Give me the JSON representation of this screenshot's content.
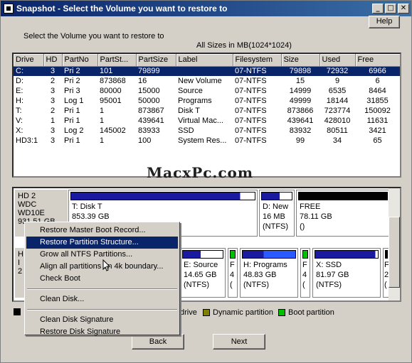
{
  "window": {
    "title": "Snapshot - Select the Volume you want to restore to",
    "help_label": "Help"
  },
  "instruction": "Select the Volume you want to restore to",
  "sizes_note": "All Sizes in MB(1024*1024)",
  "volumes": {
    "columns": [
      "Drive",
      "HD",
      "PartNo",
      "PartSt...",
      "PartSize",
      "Label",
      "Filesystem",
      "Size",
      "Used",
      "Free"
    ],
    "rows": [
      [
        "C:",
        "3",
        "Pri 2",
        "101",
        "79899",
        "",
        "07-NTFS",
        "79898",
        "72932",
        "6966"
      ],
      [
        "D:",
        "2",
        "Pri 2",
        "873868",
        "16",
        "New Volume",
        "07-NTFS",
        "15",
        "9",
        "6"
      ],
      [
        "E:",
        "3",
        "Pri 3",
        "80000",
        "15000",
        "Source",
        "07-NTFS",
        "14999",
        "6535",
        "8464"
      ],
      [
        "H:",
        "3",
        "Log 1",
        "95001",
        "50000",
        "Programs",
        "07-NTFS",
        "49999",
        "18144",
        "31855"
      ],
      [
        "T:",
        "2",
        "Pri 1",
        "1",
        "873867",
        "Disk T",
        "07-NTFS",
        "873866",
        "723774",
        "150092"
      ],
      [
        "V:",
        "1",
        "Pri 1",
        "1",
        "439641",
        "Virtual Mac...",
        "07-NTFS",
        "439641",
        "428010",
        "11631"
      ],
      [
        "X:",
        "3",
        "Log 2",
        "145002",
        "83933",
        "SSD",
        "07-NTFS",
        "83932",
        "80511",
        "3421"
      ],
      [
        "HD3:1",
        "3",
        "Pri 1",
        "1",
        "100",
        "System Res...",
        "07-NTFS",
        "99",
        "34",
        "65"
      ]
    ],
    "selected_row": 0
  },
  "watermark": "MacxPc.com",
  "disk_map": {
    "disk2": {
      "name": "HD 2",
      "model": "WDC WD10E",
      "size": "931.51 GB",
      "partitions": [
        {
          "line1": "T: Disk T",
          "line2": "853.39 GB",
          "line3": "(NTFS)"
        },
        {
          "line1": "D: New",
          "line2": "16 MB",
          "line3": "(NTFS)"
        },
        {
          "line1": "FREE",
          "line2": "78.11 GB",
          "line3": "()"
        }
      ]
    },
    "disk3": {
      "name": "H",
      "model": "I",
      "size": "2",
      "partitions": [
        {
          "line1": "E: Source",
          "line2": "14.65 GB",
          "line3": "(NTFS)"
        },
        {
          "line1": "F",
          "line2": "4",
          "line3": "("
        },
        {
          "line1": "H: Programs",
          "line2": "48.83 GB",
          "line3": "(NTFS)"
        },
        {
          "line1": "F",
          "line2": "4",
          "line3": "("
        },
        {
          "line1": "X: SSD",
          "line2": "81.97 GB",
          "line3": "(NTFS)"
        },
        {
          "line1": "F",
          "line2": "2",
          "line3": "("
        }
      ]
    }
  },
  "legend": {
    "drive": "drive",
    "dynamic": "Dynamic partition",
    "boot": "Boot partition",
    "colors": {
      "primary": "#000000",
      "dynamic": "#808000",
      "boot": "#00c000"
    }
  },
  "context_menu": {
    "items": [
      "Restore Master Boot Record...",
      "Restore Partition Structure...",
      "Grow all NTFS Partitions...",
      "Align all partitions on 4k boundary...",
      "Check Boot",
      "Clean Disk...",
      "Clean Disk Signature",
      "Restore Disk Signature"
    ],
    "highlighted": 1
  },
  "buttons": {
    "back": "Back",
    "next": "Next"
  },
  "colors": {
    "title_bar": "#0a246a",
    "selection": "#0a246a",
    "partition_bar": "#1a1aa0",
    "free_bar": "#000000"
  }
}
